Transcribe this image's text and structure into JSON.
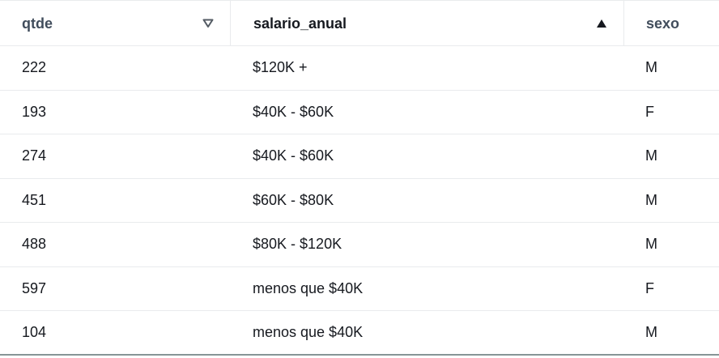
{
  "table": {
    "columns": [
      {
        "label": "qtde",
        "sort": "descending-outline"
      },
      {
        "label": "salario_anual",
        "sort": "ascending-filled"
      },
      {
        "label": "sexo",
        "sort": "none"
      }
    ],
    "rows": [
      {
        "qtde": "222",
        "salario_anual": "$120K +",
        "sexo": "M"
      },
      {
        "qtde": "193",
        "salario_anual": "$40K - $60K",
        "sexo": "F"
      },
      {
        "qtde": "274",
        "salario_anual": "$40K - $60K",
        "sexo": "M"
      },
      {
        "qtde": "451",
        "salario_anual": "$60K - $80K",
        "sexo": "M"
      },
      {
        "qtde": "488",
        "salario_anual": "$80K - $120K",
        "sexo": "M"
      },
      {
        "qtde": "597",
        "salario_anual": "menos que $40K",
        "sexo": "F"
      },
      {
        "qtde": "104",
        "salario_anual": "menos que $40K",
        "sexo": "M"
      }
    ]
  },
  "colors": {
    "border": "#e9ebed",
    "header_text": "#414d5c",
    "text": "#16191f",
    "icon": "#545b64"
  },
  "icons": {
    "qtde_sort": "sort-descending-outline-triangle-icon",
    "salario_sort": "sort-ascending-filled-triangle-icon"
  }
}
